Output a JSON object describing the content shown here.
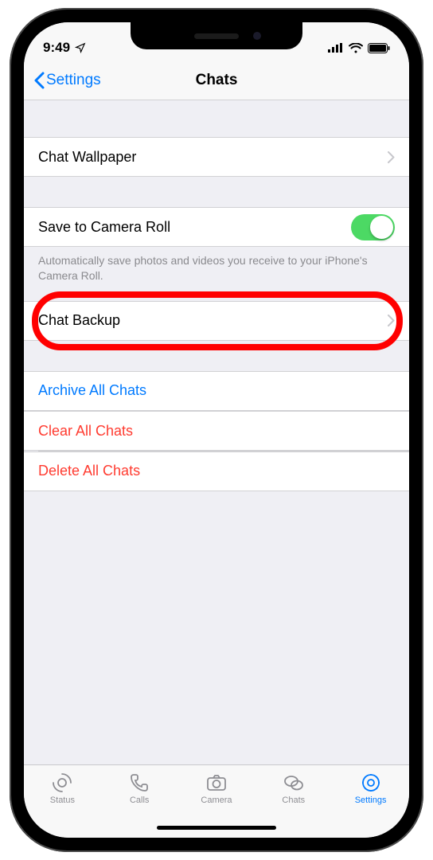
{
  "status": {
    "time": "9:49"
  },
  "nav": {
    "back_label": "Settings",
    "title": "Chats"
  },
  "rows": {
    "wallpaper": "Chat Wallpaper",
    "camera_roll": "Save to Camera Roll",
    "camera_roll_footer": "Automatically save photos and videos you receive to your iPhone's Camera Roll.",
    "backup": "Chat Backup",
    "archive": "Archive All Chats",
    "clear": "Clear All Chats",
    "delete": "Delete All Chats"
  },
  "tabs": {
    "status": "Status",
    "calls": "Calls",
    "camera": "Camera",
    "chats": "Chats",
    "settings": "Settings"
  }
}
